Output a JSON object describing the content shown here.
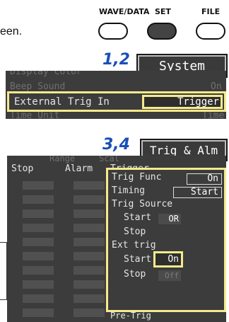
{
  "intro_text": "een.",
  "hardware_buttons": [
    {
      "label": "WAVE/DATA",
      "active": false
    },
    {
      "label": "SET",
      "active": true
    },
    {
      "label": "FILE",
      "active": false
    }
  ],
  "steps": {
    "first": "1,2",
    "second": "3,4"
  },
  "tabs": {
    "system": "System",
    "trig_alm": "Trig & Alm"
  },
  "system_panel": {
    "top_dim_1": "Display Color",
    "row_dim_label": "Beep Sound",
    "row_dim_value": "On",
    "ext_trig_label": "External Trig In",
    "ext_trig_value": "Trigger",
    "bottom_dim": "Time Unit",
    "bottom_dim_value": "Time"
  },
  "trig_panel": {
    "header_range": "Range",
    "header_scale": "Scal",
    "col_stop": "Stop",
    "col_alarm": "Alarm",
    "col_trigger": "Trigger",
    "cell_off": "OFF",
    "trig_func_label": "Trig Func",
    "trig_func_value": "On",
    "timing_label": "Timing",
    "timing_value": "Start",
    "trig_source_label": "Trig Source",
    "src_start_label": "Start",
    "src_start_value": "OR",
    "src_stop_label": "Stop",
    "ext_trig_label": "Ext trig",
    "ext_start_label": "Start",
    "ext_start_value": "On",
    "ext_stop_label": "Stop",
    "ext_stop_value": "Off",
    "pre_trig_label": "Pre-Trig"
  },
  "colors": {
    "highlight": "#f6ea8c",
    "step_blue": "#1a4fb8",
    "screen_bg": "#3c3c3c"
  }
}
